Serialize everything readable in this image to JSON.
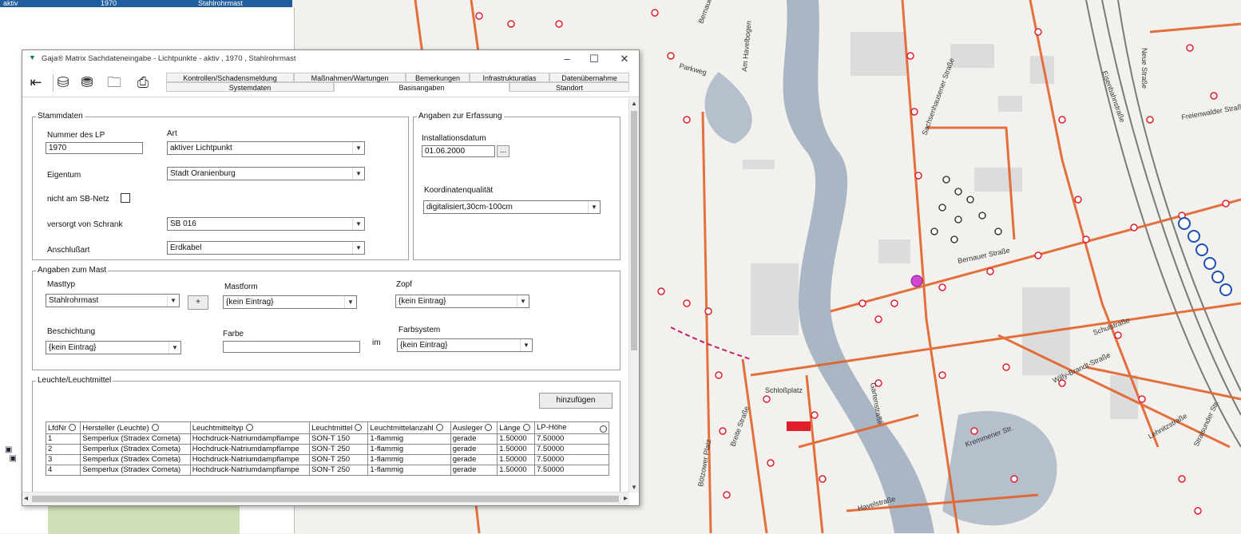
{
  "background": {
    "top_row": [
      "aktiv",
      "1970",
      "Stahlrohrmast"
    ],
    "street_labels": [
      "Bernauer Str.",
      "Am Havelbogen",
      "Parkweg",
      "Neue Straße",
      "Schulstraße",
      "Willy-Brandt-Straße",
      "Lehnitzstraße",
      "Stralsunder Str.",
      "Bernauer Straße",
      "Schloßplatz",
      "Breite Straße",
      "Havelstraße",
      "Kremmener Str.",
      "Bötzower Platz",
      "Sachsenhausener Straße",
      "Freienwalder Straße",
      "Eisenbahnstraße",
      "Gartenstraße"
    ]
  },
  "dialog": {
    "title": "Gaja® Matrix Sachdateneingabe - Lichtpunkte -  aktiv ,   1970 , Stahlrohrmast",
    "window_buttons": {
      "minimize": "–",
      "maximize": "☐",
      "close": "✕"
    },
    "tabs_top": [
      "Kontrollen/Schadensmeldung",
      "Maßnahmen/Wartungen",
      "Bemerkungen",
      "Infrastrukturatlas",
      "Datenübernahme"
    ],
    "tabs_bottom": [
      "Systemdaten",
      "Basisangaben",
      "Standort"
    ],
    "active_tab": "Basisangaben",
    "stammdaten": {
      "title": "Stammdaten",
      "nummer_label": "Nummer des LP",
      "nummer_value": "1970",
      "art_label": "Art",
      "art_value": "aktiver Lichtpunkt",
      "eigentum_label": "Eigentum",
      "eigentum_value": "Stadt Oranienburg",
      "sbnetz_label": "nicht am SB-Netz",
      "versorgt_label": "versorgt von Schrank",
      "versorgt_value": "SB 016",
      "anschluss_label": "Anschlußart",
      "anschluss_value": "Erdkabel"
    },
    "erfassung": {
      "title": "Angaben zur Erfassung",
      "install_label": "Installationsdatum",
      "install_value": "01.06.2000",
      "picker_label": "...",
      "koord_label": "Koordinatenqualität",
      "koord_value": "digitalisiert,30cm-100cm"
    },
    "mast": {
      "title": "Angaben zum Mast",
      "masttyp_label": "Masttyp",
      "masttyp_value": "Stahlrohrmast",
      "plus_label": "+",
      "mastform_label": "Mastform",
      "mastform_value": "{kein Eintrag}",
      "zopf_label": "Zopf",
      "zopf_value": "{kein Eintrag}",
      "beschichtung_label": "Beschichtung",
      "beschichtung_value": "{kein Eintrag}",
      "farbe_label": "Farbe",
      "farbe_value": "",
      "im_label": "im",
      "farbsystem_label": "Farbsystem",
      "farbsystem_value": "{kein Eintrag}"
    },
    "leuchte": {
      "title": "Leuchte/Leuchtmittel",
      "add_label": "hinzufügen",
      "columns": [
        "LfdNr",
        "Hersteller (Leuchte)",
        "Leuchtmitteltyp",
        "Leuchtmittel",
        "Leuchtmittelanzahl",
        "Ausleger",
        "Länge",
        "LP-Höhe"
      ],
      "rows": [
        [
          "1",
          "Semperlux (Stradex Cometa)",
          "Hochdruck-Natriumdampflampe",
          "SON-T 150",
          "1-flammig",
          "gerade",
          "1.50000",
          "7.50000"
        ],
        [
          "2",
          "Semperlux (Stradex Cometa)",
          "Hochdruck-Natriumdampflampe",
          "SON-T 250",
          "1-flammig",
          "gerade",
          "1.50000",
          "7.50000"
        ],
        [
          "3",
          "Semperlux (Stradex Cometa)",
          "Hochdruck-Natriumdampflampe",
          "SON-T 250",
          "1-flammig",
          "gerade",
          "1.50000",
          "7.50000"
        ],
        [
          "4",
          "Semperlux (Stradex Cometa)",
          "Hochdruck-Natriumdampflampe",
          "SON-T 250",
          "1-flammig",
          "gerade",
          "1.50000",
          "7.50000"
        ]
      ]
    }
  },
  "colors": {
    "title_accent": "#1f5d9e",
    "map_lines": "#e2622a",
    "map_points": "#e01f2b",
    "river": "#a9b6c4"
  }
}
